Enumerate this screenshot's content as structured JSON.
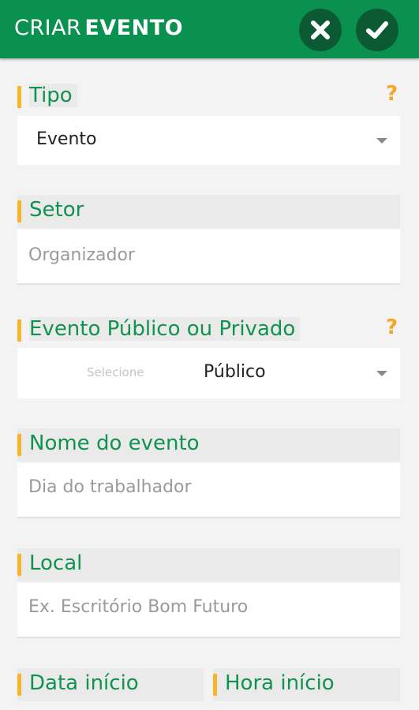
{
  "header": {
    "title_part1": "CRIAR",
    "title_part2": "EVENTO",
    "close_icon": "close-icon",
    "confirm_icon": "check-icon"
  },
  "form": {
    "tipo": {
      "label": "Tipo",
      "value": "Evento",
      "help": "?"
    },
    "setor": {
      "label": "Setor",
      "placeholder": "Organizador"
    },
    "publico": {
      "label": "Evento Público ou Privado",
      "hint": "Selecione",
      "value": "Público",
      "help": "?"
    },
    "nome": {
      "label": "Nome do evento",
      "placeholder": "Dia do trabalhador"
    },
    "local": {
      "label": "Local",
      "placeholder": "Ex. Escritório Bom Futuro"
    },
    "data_inicio": {
      "label": "Data início"
    },
    "hora_inicio": {
      "label": "Hora início"
    }
  },
  "colors": {
    "header": "#0a9150",
    "header_button": "#0b5a34",
    "label_text": "#12924f",
    "accent_bar": "#f7b52b",
    "help": "#f5a623"
  }
}
